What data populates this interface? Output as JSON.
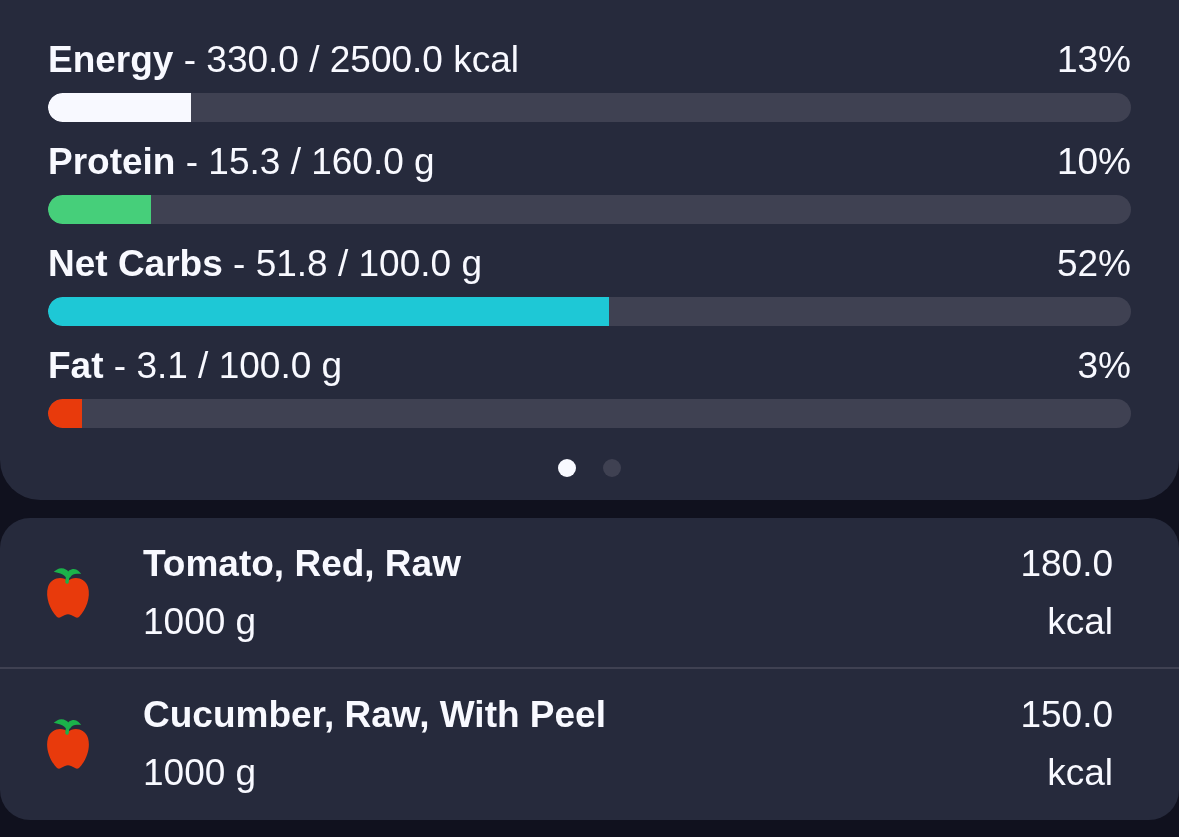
{
  "nutrients": [
    {
      "label": "**Energy** - 330.0 / 2500.0 kcal",
      "percent": "13%",
      "level": 0.132,
      "color": "#f8f9ff"
    },
    {
      "label": "**Protein** - 15.3 / 160.0 g",
      "percent": "10%",
      "level": 0.095,
      "color": "#46cf7a"
    },
    {
      "label": "**Net Carbs** - 51.8 / 100.0 g",
      "percent": "52%",
      "level": 0.518,
      "color": "#1ec8d6"
    },
    {
      "label": "**Fat** - 3.1 / 100.0 g",
      "percent": "3%",
      "level": 0.031,
      "color": "#e83a0c"
    }
  ],
  "pager_dots": [
    {
      "selected": true
    },
    {
      "selected": false
    }
  ],
  "foods": [
    {
      "name": "Tomato, Red, Raw",
      "quantity": "1000 g",
      "calories": "180.0",
      "unit": "kcal"
    },
    {
      "name": "Cucumber, Raw, With Peel",
      "quantity": "1000 g",
      "calories": "150.0",
      "unit": "kcal"
    }
  ]
}
